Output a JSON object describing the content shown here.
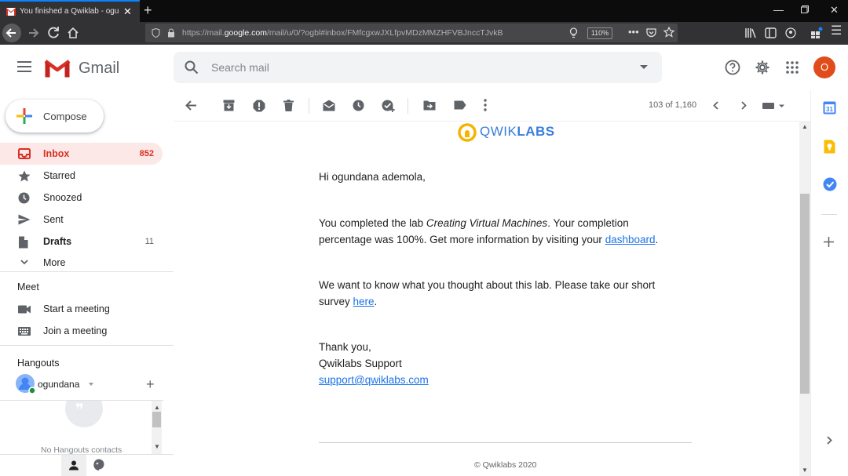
{
  "browser": {
    "tab_title": "You finished a Qwiklab - ogundana",
    "url_prefix": "https://mail.",
    "url_domain": "google.com",
    "url_path": "/mail/u/0/?ogbl#inbox/FMfcgxwJXLfpvMDzMMZHFVBJnccTJvkB",
    "zoom": "110%"
  },
  "header": {
    "app_name": "Gmail",
    "search_placeholder": "Search mail",
    "avatar_letter": "O"
  },
  "sidebar": {
    "compose": "Compose",
    "items": [
      {
        "label": "Inbox",
        "count": "852"
      },
      {
        "label": "Starred",
        "count": ""
      },
      {
        "label": "Snoozed",
        "count": ""
      },
      {
        "label": "Sent",
        "count": ""
      },
      {
        "label": "Drafts",
        "count": "11"
      },
      {
        "label": "More",
        "count": ""
      }
    ],
    "meet_title": "Meet",
    "meet_items": [
      "Start a meeting",
      "Join a meeting"
    ],
    "hangouts_title": "Hangouts",
    "hangouts_user": "ogundana",
    "no_contacts": "No Hangouts contacts"
  },
  "toolbar": {
    "pager": "103 of 1,160"
  },
  "message": {
    "brand_light": "QWIK",
    "brand_bold": "LABS",
    "greeting": "Hi ogundana ademola,",
    "p1_a": "You completed the lab ",
    "p1_lab": "Creating Virtual Machines",
    "p1_b": ". Your completion percentage was 100%. Get more information by visiting your ",
    "p1_link": "dashboard",
    "p1_end": ".",
    "p2_a": "We want to know what you thought about this lab. Please take our short survey ",
    "p2_link": "here",
    "p2_end": ".",
    "sign_1": "Thank you,",
    "sign_2": "Qwiklabs Support",
    "sign_email": "support@qwiklabs.com",
    "footer": "© Qwiklabs 2020"
  },
  "colors": {
    "accent_red": "#d93025",
    "link_blue": "#1a73e8",
    "avatar_bg": "#e04d1a",
    "qwik_yellow": "#f5b400"
  }
}
